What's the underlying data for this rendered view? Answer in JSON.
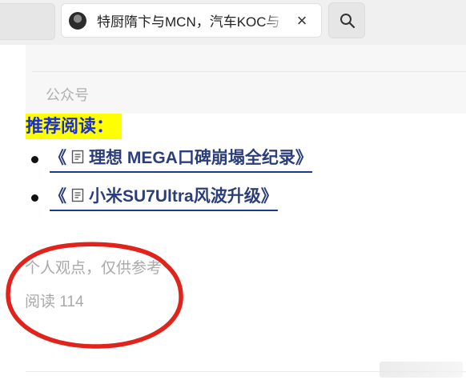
{
  "browser": {
    "tab_title": "特厨隋卞与MCN，汽车KOC与",
    "close_glyph": "×"
  },
  "account": {
    "label": "公众号"
  },
  "recommended": {
    "heading": "推荐阅读：",
    "items": [
      {
        "open": "《",
        "title": "理想 MEGA口碑崩塌全纪录",
        "close": "》"
      },
      {
        "open": "《",
        "title": "小米SU7Ultra风波升级",
        "close": "》"
      }
    ]
  },
  "footer": {
    "note": "个人观点，仅供参考",
    "read_count": "阅读 114"
  },
  "colors": {
    "highlight_bg": "#ffff00",
    "heading_text": "#1a2dd6",
    "link_text": "#2c3e7a",
    "annotation_circle": "#e0231b"
  },
  "icons": [
    "avatar",
    "close-icon",
    "search-icon",
    "document-icon"
  ]
}
